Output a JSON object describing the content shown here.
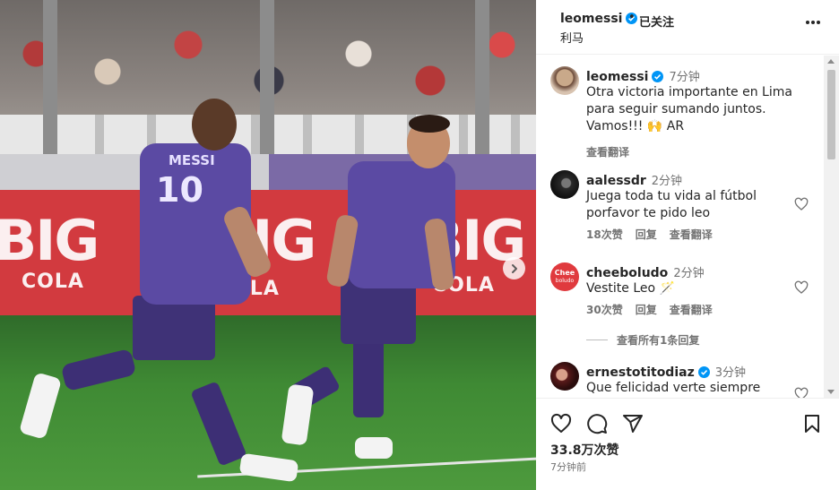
{
  "post": {
    "media_ad_texts": [
      "BIG",
      "COLA",
      "BIG",
      "COLA",
      "BIG",
      "COLA"
    ],
    "jersey_name": "MESSI",
    "jersey_number": "10"
  },
  "header": {
    "username": "leomessi",
    "separator": "•",
    "follow_status": "已关注",
    "location": "利马"
  },
  "caption": {
    "username": "leomessi",
    "time": "7分钟",
    "text_line1": "Otra victoria importante en Lima",
    "text_line2": "para seguir sumando juntos.",
    "text_line3": "Vamos!!! 🙌 AR",
    "translate": "查看翻译"
  },
  "comments": [
    {
      "username": "aalessdr",
      "time": "2分钟",
      "text_line1": "Juega toda tu vida al fútbol",
      "text_line2": "porfavor te pido leo",
      "likes": "18次赞",
      "reply": "回复",
      "translate": "查看翻译"
    },
    {
      "username": "cheeboludo",
      "time": "2分钟",
      "avatar_text_1": "Chee",
      "avatar_text_2": "boludo",
      "text_line1": "Vestite Leo 🪄",
      "likes": "30次赞",
      "reply": "回复",
      "translate": "查看翻译",
      "view_replies": "查看所有1条回复"
    },
    {
      "username": "ernestotitodiaz",
      "time": "3分钟",
      "text_line1": "Que felicidad verte siempre"
    }
  ],
  "footer": {
    "likes": "33.8万次赞",
    "posted": "7分钟前"
  },
  "colors": {
    "verified_blue": "#0095f6",
    "text": "#262626",
    "muted": "#737373",
    "jersey_purple": "#5b4aa3",
    "board_red": "#d23a3f"
  },
  "icons": [
    "verified-icon",
    "more-icon",
    "heart-icon",
    "comment-icon",
    "share-icon",
    "bookmark-icon",
    "chevron-right-icon"
  ]
}
